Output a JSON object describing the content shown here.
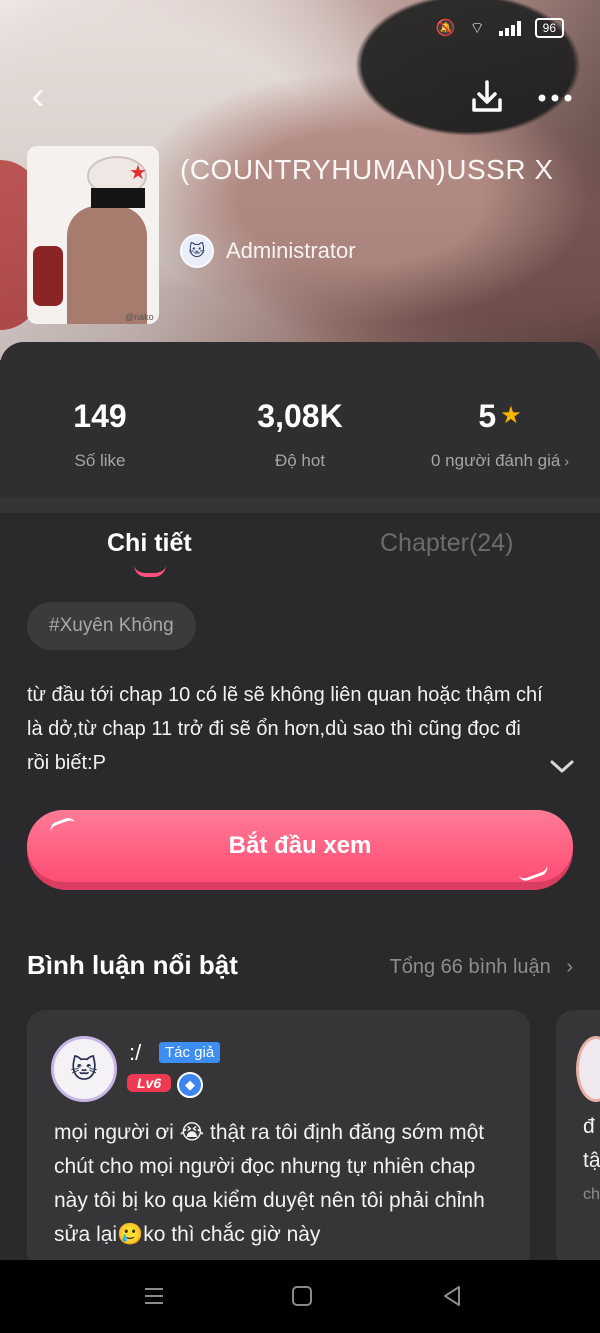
{
  "status": {
    "battery": "96"
  },
  "header": {
    "title": "(COUNTRYHUMAN)USSR X",
    "author": "Administrator",
    "icons": {
      "back": "chevron-left-icon",
      "download": "download-icon",
      "more": "more-dots-icon"
    }
  },
  "stats": [
    {
      "value": "149",
      "label": "Số like"
    },
    {
      "value": "3,08K",
      "label": "Độ hot"
    },
    {
      "value": "5",
      "label": "0 người đánh giá"
    }
  ],
  "tabs": {
    "detail": "Chi tiết",
    "chapter": "Chapter(24)"
  },
  "tag": "#Xuyên Không",
  "description": "từ đầu tới chap 10 có lẽ sẽ không liên quan hoặc thậm chí là dở,từ chap 11 trở đi sẽ ổn hơn,dù sao thì cũng đọc đi rồi biết:P",
  "start_button": "Bắt đầu xem",
  "comments_section": {
    "title": "Bình luận nổi bật",
    "total": "Tổng 66 bình luận"
  },
  "comment": {
    "user": ":/",
    "author_badge": "Tác giả",
    "level": "Lv6",
    "text": "mọi người ơi 😭 thật ra tôi định đăng sớm một chút cho mọi người đọc nhưng tự nhiên chap này tôi bị ko qua kiểm duyệt nên tôi phải chỉnh sửa lại🥲ko thì chắc giờ này"
  },
  "comment2_partial": {
    "line1": "đ",
    "line2": "tậ",
    "line3": "ch"
  }
}
